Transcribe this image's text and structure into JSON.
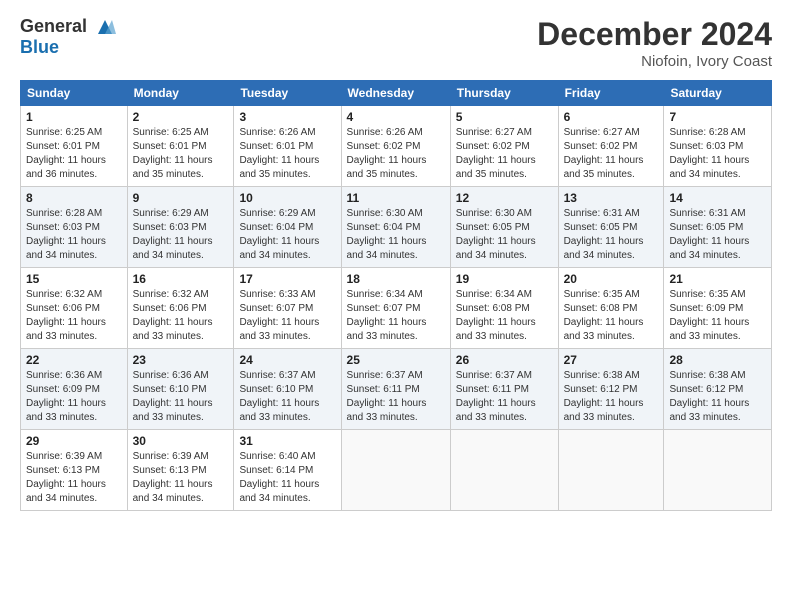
{
  "logo": {
    "line1": "General",
    "line2": "Blue"
  },
  "title": "December 2024",
  "location": "Niofoin, Ivory Coast",
  "days_header": [
    "Sunday",
    "Monday",
    "Tuesday",
    "Wednesday",
    "Thursday",
    "Friday",
    "Saturday"
  ],
  "weeks": [
    [
      {
        "day": "1",
        "sunrise": "6:25 AM",
        "sunset": "6:01 PM",
        "daylight": "11 hours and 36 minutes."
      },
      {
        "day": "2",
        "sunrise": "6:25 AM",
        "sunset": "6:01 PM",
        "daylight": "11 hours and 35 minutes."
      },
      {
        "day": "3",
        "sunrise": "6:26 AM",
        "sunset": "6:01 PM",
        "daylight": "11 hours and 35 minutes."
      },
      {
        "day": "4",
        "sunrise": "6:26 AM",
        "sunset": "6:02 PM",
        "daylight": "11 hours and 35 minutes."
      },
      {
        "day": "5",
        "sunrise": "6:27 AM",
        "sunset": "6:02 PM",
        "daylight": "11 hours and 35 minutes."
      },
      {
        "day": "6",
        "sunrise": "6:27 AM",
        "sunset": "6:02 PM",
        "daylight": "11 hours and 35 minutes."
      },
      {
        "day": "7",
        "sunrise": "6:28 AM",
        "sunset": "6:03 PM",
        "daylight": "11 hours and 34 minutes."
      }
    ],
    [
      {
        "day": "8",
        "sunrise": "6:28 AM",
        "sunset": "6:03 PM",
        "daylight": "11 hours and 34 minutes."
      },
      {
        "day": "9",
        "sunrise": "6:29 AM",
        "sunset": "6:03 PM",
        "daylight": "11 hours and 34 minutes."
      },
      {
        "day": "10",
        "sunrise": "6:29 AM",
        "sunset": "6:04 PM",
        "daylight": "11 hours and 34 minutes."
      },
      {
        "day": "11",
        "sunrise": "6:30 AM",
        "sunset": "6:04 PM",
        "daylight": "11 hours and 34 minutes."
      },
      {
        "day": "12",
        "sunrise": "6:30 AM",
        "sunset": "6:05 PM",
        "daylight": "11 hours and 34 minutes."
      },
      {
        "day": "13",
        "sunrise": "6:31 AM",
        "sunset": "6:05 PM",
        "daylight": "11 hours and 34 minutes."
      },
      {
        "day": "14",
        "sunrise": "6:31 AM",
        "sunset": "6:05 PM",
        "daylight": "11 hours and 34 minutes."
      }
    ],
    [
      {
        "day": "15",
        "sunrise": "6:32 AM",
        "sunset": "6:06 PM",
        "daylight": "11 hours and 33 minutes."
      },
      {
        "day": "16",
        "sunrise": "6:32 AM",
        "sunset": "6:06 PM",
        "daylight": "11 hours and 33 minutes."
      },
      {
        "day": "17",
        "sunrise": "6:33 AM",
        "sunset": "6:07 PM",
        "daylight": "11 hours and 33 minutes."
      },
      {
        "day": "18",
        "sunrise": "6:34 AM",
        "sunset": "6:07 PM",
        "daylight": "11 hours and 33 minutes."
      },
      {
        "day": "19",
        "sunrise": "6:34 AM",
        "sunset": "6:08 PM",
        "daylight": "11 hours and 33 minutes."
      },
      {
        "day": "20",
        "sunrise": "6:35 AM",
        "sunset": "6:08 PM",
        "daylight": "11 hours and 33 minutes."
      },
      {
        "day": "21",
        "sunrise": "6:35 AM",
        "sunset": "6:09 PM",
        "daylight": "11 hours and 33 minutes."
      }
    ],
    [
      {
        "day": "22",
        "sunrise": "6:36 AM",
        "sunset": "6:09 PM",
        "daylight": "11 hours and 33 minutes."
      },
      {
        "day": "23",
        "sunrise": "6:36 AM",
        "sunset": "6:10 PM",
        "daylight": "11 hours and 33 minutes."
      },
      {
        "day": "24",
        "sunrise": "6:37 AM",
        "sunset": "6:10 PM",
        "daylight": "11 hours and 33 minutes."
      },
      {
        "day": "25",
        "sunrise": "6:37 AM",
        "sunset": "6:11 PM",
        "daylight": "11 hours and 33 minutes."
      },
      {
        "day": "26",
        "sunrise": "6:37 AM",
        "sunset": "6:11 PM",
        "daylight": "11 hours and 33 minutes."
      },
      {
        "day": "27",
        "sunrise": "6:38 AM",
        "sunset": "6:12 PM",
        "daylight": "11 hours and 33 minutes."
      },
      {
        "day": "28",
        "sunrise": "6:38 AM",
        "sunset": "6:12 PM",
        "daylight": "11 hours and 33 minutes."
      }
    ],
    [
      {
        "day": "29",
        "sunrise": "6:39 AM",
        "sunset": "6:13 PM",
        "daylight": "11 hours and 34 minutes."
      },
      {
        "day": "30",
        "sunrise": "6:39 AM",
        "sunset": "6:13 PM",
        "daylight": "11 hours and 34 minutes."
      },
      {
        "day": "31",
        "sunrise": "6:40 AM",
        "sunset": "6:14 PM",
        "daylight": "11 hours and 34 minutes."
      },
      null,
      null,
      null,
      null
    ]
  ]
}
